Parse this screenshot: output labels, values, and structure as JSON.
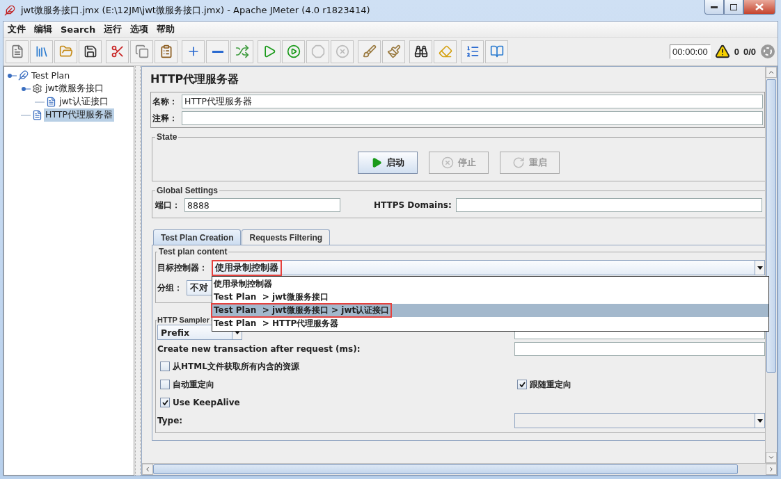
{
  "window": {
    "title": "jwt微服务接口.jmx (E:\\12JM\\jwt微服务接口.jmx) - Apache JMeter (4.0 r1823414)"
  },
  "menu": [
    {
      "label": "文件"
    },
    {
      "label": "编辑"
    },
    {
      "label": "Search"
    },
    {
      "label": "运行"
    },
    {
      "label": "选项"
    },
    {
      "label": "帮助"
    }
  ],
  "toolbar": [
    [
      {
        "kind": "new",
        "disabled": false
      },
      {
        "kind": "templates",
        "disabled": false
      },
      {
        "kind": "open",
        "disabled": false
      },
      {
        "kind": "save",
        "disabled": false
      }
    ],
    [
      {
        "kind": "cut",
        "disabled": false
      },
      {
        "kind": "copy",
        "disabled": false
      },
      {
        "kind": "paste",
        "disabled": false
      }
    ],
    [
      {
        "kind": "expand",
        "disabled": false
      },
      {
        "kind": "collapse",
        "disabled": false
      },
      {
        "kind": "toggle",
        "disabled": false
      }
    ],
    [
      {
        "kind": "start",
        "disabled": false
      },
      {
        "kind": "start_no_pause",
        "disabled": false
      },
      {
        "kind": "stop",
        "disabled": true
      },
      {
        "kind": "shutdown",
        "disabled": true
      }
    ],
    [
      {
        "kind": "clear",
        "disabled": false
      },
      {
        "kind": "clear_all",
        "disabled": false
      }
    ],
    [
      {
        "kind": "search",
        "disabled": false
      },
      {
        "kind": "reset_search",
        "disabled": false
      }
    ],
    [
      {
        "kind": "function_helper",
        "disabled": false
      },
      {
        "kind": "help",
        "disabled": false
      }
    ]
  ],
  "status": {
    "timer": "00:00:00",
    "warnings": "0",
    "threads": "0/0"
  },
  "tree": [
    {
      "label": "Test Plan",
      "kind": "plan",
      "selected": false,
      "children": [
        {
          "label": "jwt微服务接口",
          "kind": "controller",
          "selected": false,
          "children": [
            {
              "label": "jwt认证接口",
              "kind": "sampler",
              "selected": false
            }
          ]
        },
        {
          "label": "HTTP代理服务器",
          "kind": "sampler",
          "selected": true
        }
      ]
    }
  ],
  "editor": {
    "title": "HTTP代理服务器",
    "name_label": "名称：",
    "name_value": "HTTP代理服务器",
    "comment_label": "注释：",
    "state": {
      "legend": "State",
      "buttons": [
        {
          "kind": "start",
          "label": "启动",
          "disabled": false
        },
        {
          "kind": "stop",
          "label": "停止",
          "disabled": true
        },
        {
          "kind": "restart",
          "label": "重启",
          "disabled": true
        }
      ]
    },
    "global": {
      "legend": "Global Settings",
      "port_label": "端口：",
      "port_value": "8888",
      "https_label": "HTTPS Domains:"
    },
    "tabs": [
      {
        "label": "Test Plan Creation",
        "selected": true
      },
      {
        "label": "Requests Filtering",
        "selected": false
      }
    ],
    "content": {
      "legend": "Test plan content",
      "target_label": "目标控制器：",
      "target_value": "使用录制控制器",
      "target_highlighted": true,
      "group_label": "分组：",
      "group_value": "不对",
      "dropdown": [
        {
          "label": "使用录制控制器",
          "selected": false,
          "highlighted": false
        },
        {
          "label": "Test Plan  > jwt微服务接口",
          "selected": false,
          "highlighted": false
        },
        {
          "label": "Test Plan  > jwt微服务接口 > jwt认证接口",
          "selected": true,
          "highlighted": true
        },
        {
          "label": "Test Plan  > HTTP代理服务器",
          "selected": false,
          "highlighted": false
        }
      ]
    },
    "sampler": {
      "legend": "HTTP Sampler",
      "prefix_value": "Prefix",
      "transaction_label": "Create new transaction after request (ms):",
      "option_rows": [
        [
          {
            "label": "从HTML文件获取所有内含的资源",
            "checked": false
          }
        ],
        [
          {
            "label": "自动重定向",
            "checked": false
          },
          {
            "label": "跟随重定向",
            "checked": true
          }
        ],
        [
          {
            "label": "Use KeepAlive",
            "checked": true
          }
        ]
      ],
      "type_label": "Type:"
    }
  }
}
